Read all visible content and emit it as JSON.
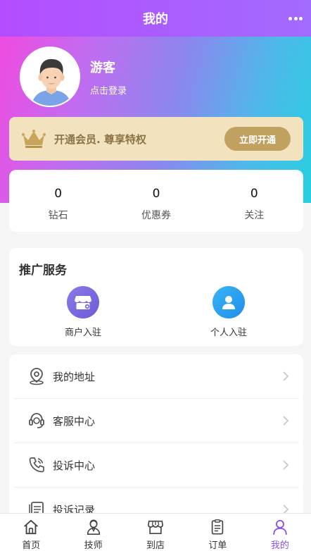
{
  "header": {
    "title": "我的"
  },
  "profile": {
    "name": "游客",
    "login_text": "点击登录"
  },
  "vip": {
    "text": "开通会员. 尊享特权",
    "button": "立即开通"
  },
  "stats": [
    {
      "value": "0",
      "label": "钻石"
    },
    {
      "value": "0",
      "label": "优惠券"
    },
    {
      "value": "0",
      "label": "关注"
    }
  ],
  "promo": {
    "title": "推广服务",
    "items": [
      {
        "label": "商户入驻",
        "icon": "store-icon"
      },
      {
        "label": "个人入驻",
        "icon": "person-icon"
      }
    ]
  },
  "menu": [
    {
      "label": "我的地址",
      "icon": "location-icon"
    },
    {
      "label": "客服中心",
      "icon": "headset-icon"
    },
    {
      "label": "投诉中心",
      "icon": "phone-icon"
    },
    {
      "label": "投诉记录",
      "icon": "document-icon"
    }
  ],
  "tabs": [
    {
      "label": "首页",
      "icon": "home-icon"
    },
    {
      "label": "技师",
      "icon": "technician-icon"
    },
    {
      "label": "到店",
      "icon": "shop-icon"
    },
    {
      "label": "订单",
      "icon": "order-icon"
    },
    {
      "label": "我的",
      "icon": "user-icon",
      "active": true
    }
  ],
  "colors": {
    "accent": "#8b52e8",
    "gold": "#c1a160",
    "vip_bg": "#f2e2be"
  }
}
